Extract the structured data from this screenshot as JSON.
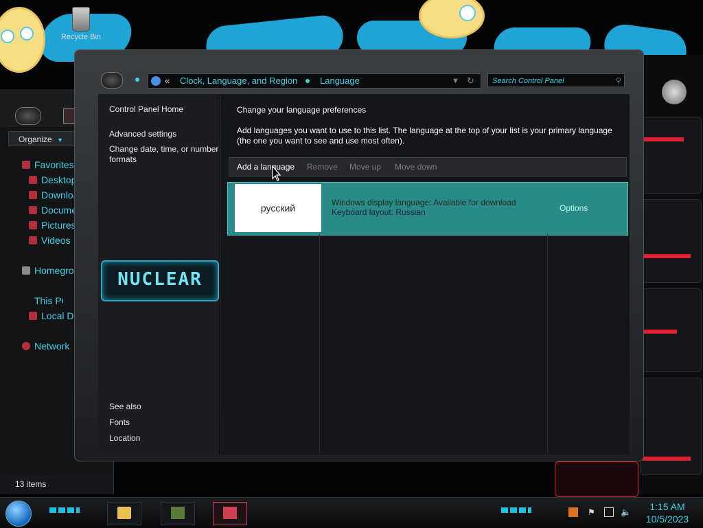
{
  "desktop": {
    "recycle_bin_label": "Recycle Bin"
  },
  "explorer": {
    "organize_label": "Organize",
    "nav": [
      {
        "label": "Favorites"
      },
      {
        "label": "Desktop"
      },
      {
        "label": "Downloads"
      },
      {
        "label": "Documents"
      },
      {
        "label": "Pictures"
      },
      {
        "label": "Videos"
      },
      {
        "label": "Homegroup"
      },
      {
        "label": "This PC"
      },
      {
        "label": "Local Disk"
      },
      {
        "label": "Network"
      }
    ],
    "status": "13 items"
  },
  "window": {
    "address": {
      "crumb1": "Clock, Language, and Region",
      "crumb2": "Language",
      "chevron": "«"
    },
    "search_placeholder": "Search Control Panel",
    "sidebar": {
      "links": [
        {
          "label": "Control Panel Home"
        },
        {
          "label": "Advanced settings"
        },
        {
          "label": "Change date, time, or number formats"
        }
      ],
      "brand": "NUCLEAR",
      "see_also_heading": "See also",
      "see_also": [
        {
          "label": "Fonts"
        },
        {
          "label": "Location"
        }
      ]
    },
    "main": {
      "heading": "Change your language preferences",
      "description": "Add languages you want to use to this list. The language at the top of your list is your primary language (the one you want to see and use most often).",
      "toolbar": {
        "add": "Add a language",
        "remove": "Remove",
        "move_up": "Move up",
        "move_down": "Move down"
      },
      "languages": [
        {
          "name": "русский",
          "display_status": "Windows display language: Available for download",
          "keyboard": "Keyboard layout: Russian",
          "options_label": "Options"
        }
      ]
    }
  },
  "taskbar": {
    "time": "1:15 AM",
    "date": "10/5/2023"
  },
  "colors": {
    "accent_cyan": "#3fd0e6",
    "selected_row": "#2a8a88",
    "alert_red": "#e02030"
  }
}
